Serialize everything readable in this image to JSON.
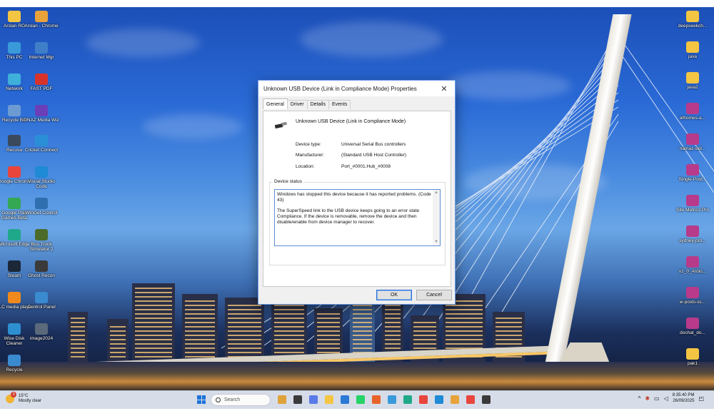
{
  "desktop": {
    "left_icons": [
      {
        "label": "Arslan RO",
        "icon": "folder-icon",
        "color": "#f4c542"
      },
      {
        "label": "Arslan - Chrome",
        "icon": "chrome-profile-icon",
        "color": "#e8a23a"
      },
      {
        "label": "This PC",
        "icon": "pc-icon",
        "color": "#3a9ad9"
      },
      {
        "label": "Internet Mgr",
        "icon": "download-manager-icon",
        "color": "#3e7fc7"
      },
      {
        "label": "Network",
        "icon": "network-icon",
        "color": "#3fb0d9"
      },
      {
        "label": "FAST PDF",
        "icon": "pdf-icon",
        "color": "#d8332a"
      },
      {
        "label": "Recycle Bin",
        "icon": "recycle-bin-icon",
        "color": "#6d9ad1"
      },
      {
        "label": "DNAZ Media Wiz",
        "icon": "media-icon",
        "color": "#6a3fb8"
      },
      {
        "label": "Recuva",
        "icon": "recuva-icon",
        "color": "#3a4a5c"
      },
      {
        "label": "Cricket Connect",
        "icon": "cricket-icon",
        "color": "#2a8fd6"
      },
      {
        "label": "Google Chrome",
        "icon": "chrome-icon",
        "color": "#e8453c"
      },
      {
        "label": "Visual Studio Code",
        "icon": "vscode-icon",
        "color": "#1f8ad6"
      },
      {
        "label": "Google Play Games Beta",
        "icon": "play-games-icon",
        "color": "#34a853"
      },
      {
        "label": "WinGet Control",
        "icon": "winget-icon",
        "color": "#2f6fb0"
      },
      {
        "label": "Microsoft Edge",
        "icon": "edge-icon",
        "color": "#1fa88a"
      },
      {
        "label": "Bus Truck Simulator 2",
        "icon": "truck-sim-icon",
        "color": "#4b6b2a"
      },
      {
        "label": "Steam",
        "icon": "steam-icon",
        "color": "#1b2838"
      },
      {
        "label": "Ghost Recon",
        "icon": "game-icon",
        "color": "#3a3a3a"
      },
      {
        "label": "VLC media player",
        "icon": "vlc-icon",
        "color": "#f08a1c"
      },
      {
        "label": "Control Panel",
        "icon": "control-panel-icon",
        "color": "#3a8ad0"
      },
      {
        "label": "Wise Disk Cleaner",
        "icon": "disk-cleaner-icon",
        "color": "#2e8fd0"
      },
      {
        "label": "image2024",
        "icon": "image-file-icon",
        "color": "#5a6a7a"
      },
      {
        "label": "Recycle",
        "icon": "folder-icon",
        "color": "#3a8ad0"
      }
    ],
    "right_icons": [
      {
        "label": "deepseekch...",
        "icon": "folder-icon",
        "color": "#f4c542"
      },
      {
        "label": "java",
        "icon": "folder-icon",
        "color": "#f4c542"
      },
      {
        "label": "java2",
        "icon": "folder-icon",
        "color": "#f4c542"
      },
      {
        "label": "athomes-a...",
        "icon": "archive-icon",
        "color": "#b83a8a"
      },
      {
        "label": "namaz-skil...",
        "icon": "archive-icon",
        "color": "#b83a8a"
      },
      {
        "label": "Single-Post...",
        "icon": "archive-icon",
        "color": "#b83a8a"
      },
      {
        "label": "Site Metrics Pro",
        "icon": "archive-icon",
        "color": "#b83a8a"
      },
      {
        "label": "sydney-pro...",
        "icon": "archive-icon",
        "color": "#b83a8a"
      },
      {
        "label": "v1_0_Ardio...",
        "icon": "archive-icon",
        "color": "#b83a8a"
      },
      {
        "label": "w-posts-sc...",
        "icon": "archive-icon",
        "color": "#b83a8a"
      },
      {
        "label": "dochat_do...",
        "icon": "archive-icon",
        "color": "#b83a8a"
      },
      {
        "label": "pak1",
        "icon": "folder-icon",
        "color": "#f4c542"
      }
    ]
  },
  "dialog": {
    "title": "Unknown USB Device (Link in Compliance Mode) Properties",
    "close_label": "✕",
    "tabs": [
      "General",
      "Driver",
      "Details",
      "Events"
    ],
    "active_tab": "General",
    "device_name": "Unknown USB Device (Link in Compliance Mode)",
    "properties": [
      {
        "key": "Device type:",
        "value": "Universal Serial Bus controllers"
      },
      {
        "key": "Manufacturer:",
        "value": "(Standard USB Host Controller)"
      },
      {
        "key": "Location:",
        "value": "Port_#0001.Hub_#0008"
      }
    ],
    "status_legend": "Device status",
    "status_paragraphs": [
      "Windows has stopped this device because it has reported problems. (Code 43)",
      "The SuperSpeed link to the USB device keeps going to an error state Compliance. If the device is removable, remove the device and then disable/enable from device manager to recover."
    ],
    "ok_label": "OK",
    "cancel_label": "Cancel"
  },
  "taskbar": {
    "weather": {
      "temp": "15°C",
      "condition": "Mostly clear",
      "badge": "3"
    },
    "search_placeholder": "Search",
    "apps": [
      {
        "icon": "widgets-icon",
        "color": "#e0a23a"
      },
      {
        "icon": "task-view-icon",
        "color": "#3a3a3a"
      },
      {
        "icon": "copilot-icon",
        "color": "#5a7ae8"
      },
      {
        "icon": "file-explorer-icon",
        "color": "#f4c542"
      },
      {
        "icon": "store-icon",
        "color": "#2a7ad6"
      },
      {
        "icon": "whatsapp-icon",
        "color": "#25d366"
      },
      {
        "icon": "media-player-icon",
        "color": "#e8632a"
      },
      {
        "icon": "notepad-icon",
        "color": "#3a9ad9"
      },
      {
        "icon": "edge-icon",
        "color": "#1fa88a"
      },
      {
        "icon": "chrome-icon",
        "color": "#e8453c"
      },
      {
        "icon": "vscode-icon",
        "color": "#1f8ad6"
      },
      {
        "icon": "chrome-profile-icon",
        "color": "#e8a23a"
      },
      {
        "icon": "chrome-icon",
        "color": "#e8453c"
      },
      {
        "icon": "settings-icon",
        "color": "#3a3a3a"
      }
    ],
    "tray_chevron": "^",
    "time": "8:35:40 PM",
    "date": "26/09/2025"
  }
}
